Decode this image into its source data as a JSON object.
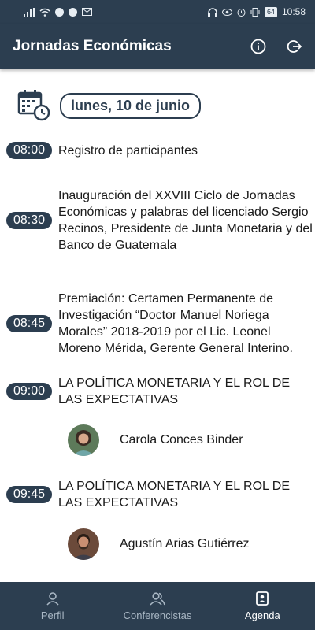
{
  "status_bar": {
    "battery": "64",
    "time": "10:58"
  },
  "app_bar": {
    "title": "Jornadas Económicas"
  },
  "date": {
    "label": "lunes, 10 de junio"
  },
  "events": [
    {
      "time": "08:00",
      "text": "Registro de participantes"
    },
    {
      "time": "08:30",
      "text": "Inauguración del XXVIII Ciclo de Jornadas Económicas y palabras del licenciado Sergio Recinos, Presidente de Junta Monetaria y del Banco de Guatemala"
    },
    {
      "time": "08:45",
      "text": "Premiación: Certamen Permanente de Investigación “Doctor Manuel Noriega Morales” 2018-2019 por el Lic. Leonel Moreno Mérida, Gerente General Interino."
    },
    {
      "time": "09:00",
      "text": "LA POLÍTICA MONETARIA Y EL ROL DE LAS EXPECTATIVAS"
    },
    {
      "time": "09:45",
      "text": "LA POLÍTICA MONETARIA Y EL ROL DE LAS EXPECTATIVAS"
    }
  ],
  "speakers": [
    {
      "name": "Carola Conces Binder"
    },
    {
      "name": "Agustín Arias Gutiérrez"
    }
  ],
  "bottom_nav": [
    {
      "label": "Perfil",
      "icon": "person-icon"
    },
    {
      "label": "Conferencistas",
      "icon": "people-icon"
    },
    {
      "label": "Agenda",
      "icon": "agenda-icon",
      "active": true
    }
  ],
  "colors": {
    "primary": "#2c3e50",
    "nav_inactive": "#a9b7c4"
  }
}
